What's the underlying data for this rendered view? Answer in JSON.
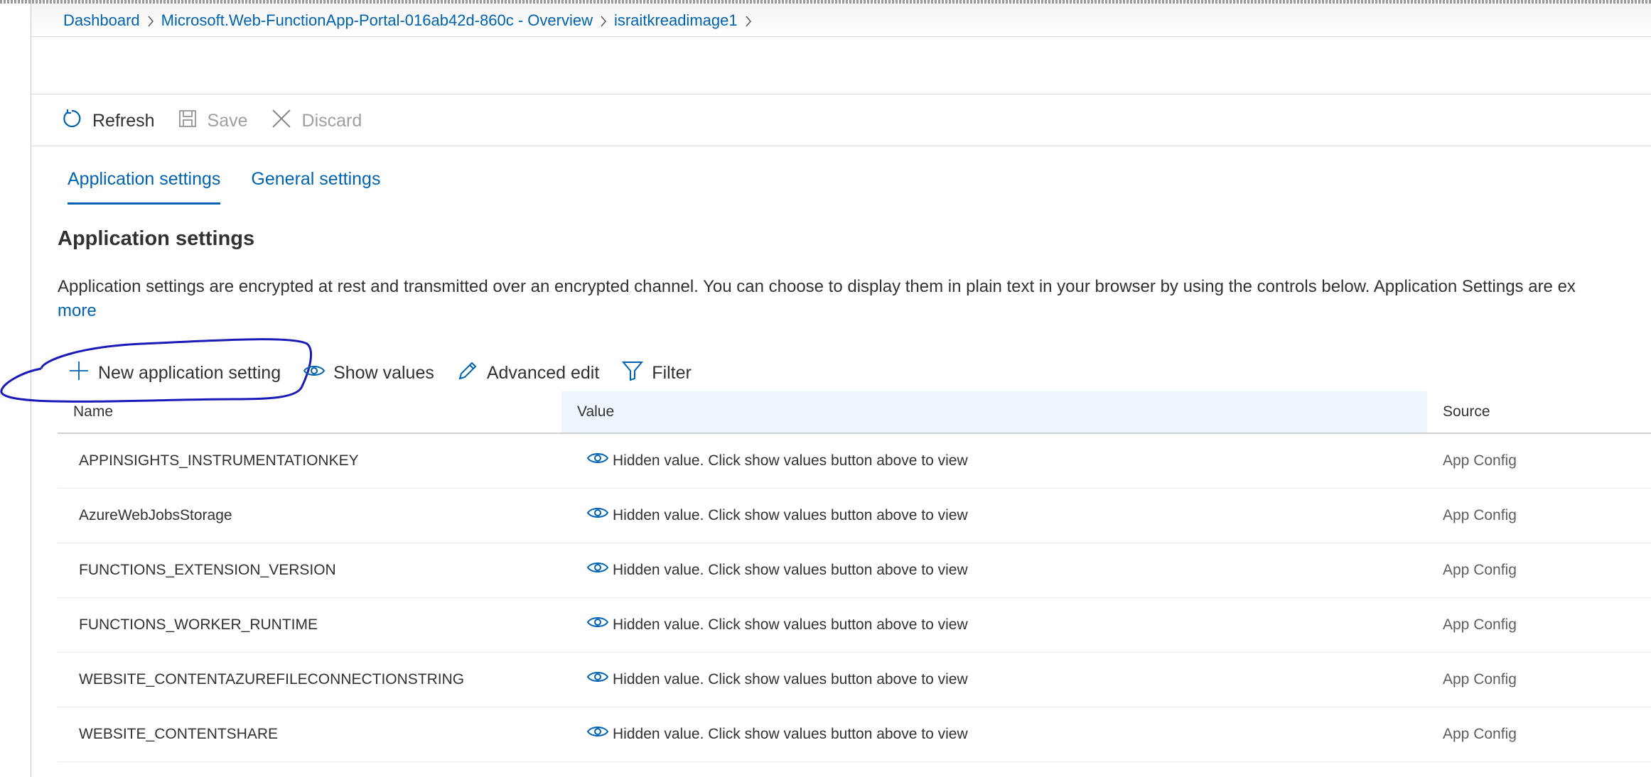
{
  "breadcrumb": {
    "items": [
      "Dashboard",
      "Microsoft.Web-FunctionApp-Portal-016ab42d-860c - Overview",
      "israitkreadimage1"
    ]
  },
  "toolbar": {
    "refresh_label": "Refresh",
    "save_label": "Save",
    "discard_label": "Discard"
  },
  "tabs": [
    {
      "label": "Application settings",
      "active": true
    },
    {
      "label": "General settings",
      "active": false
    }
  ],
  "section": {
    "title": "Application settings",
    "description": "Application settings are encrypted at rest and transmitted over an encrypted channel. You can choose to display them in plain text in your browser by using the controls below. Application Settings are ex",
    "more_link": "more"
  },
  "commands": {
    "new_setting": "New application setting",
    "show_values": "Show values",
    "advanced_edit": "Advanced edit",
    "filter": "Filter"
  },
  "grid": {
    "columns": [
      "Name",
      "Value",
      "Source"
    ],
    "rows": [
      {
        "name": "APPINSIGHTS_INSTRUMENTATIONKEY",
        "value": "Hidden value. Click show values button above to view",
        "source": "App Config"
      },
      {
        "name": "AzureWebJobsStorage",
        "value": "Hidden value. Click show values button above to view",
        "source": "App Config"
      },
      {
        "name": "FUNCTIONS_EXTENSION_VERSION",
        "value": "Hidden value. Click show values button above to view",
        "source": "App Config"
      },
      {
        "name": "FUNCTIONS_WORKER_RUNTIME",
        "value": "Hidden value. Click show values button above to view",
        "source": "App Config"
      },
      {
        "name": "WEBSITE_CONTENTAZUREFILECONNECTIONSTRING",
        "value": "Hidden value. Click show values button above to view",
        "source": "App Config"
      },
      {
        "name": "WEBSITE_CONTENTSHARE",
        "value": "Hidden value. Click show values button above to view",
        "source": "App Config"
      }
    ]
  },
  "colors": {
    "link": "#0063b1",
    "annotation": "#1a1ab8",
    "value_header_bg": "#eef5fe"
  },
  "icons": {
    "refresh": "refresh-icon",
    "save": "save-icon",
    "discard": "close-icon",
    "new": "plus-icon",
    "show": "eye-icon",
    "edit": "pencil-icon",
    "filter": "filter-icon"
  }
}
